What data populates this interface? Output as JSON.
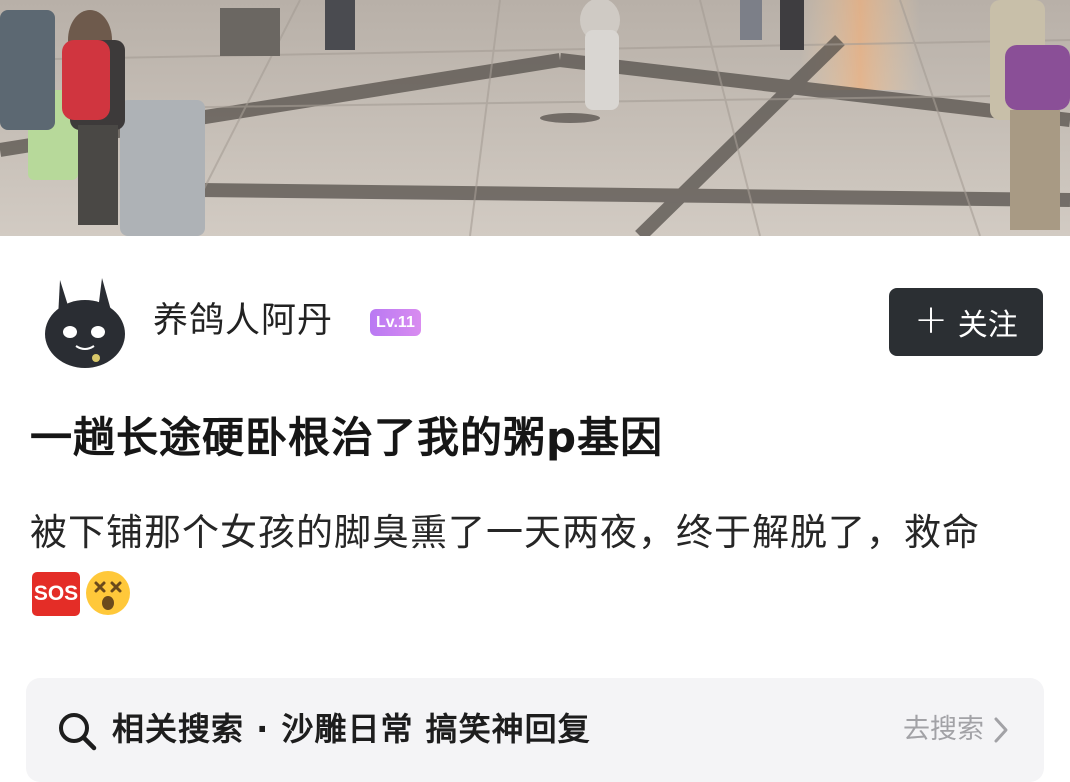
{
  "author": {
    "name": "养鸽人阿丹",
    "level": "Lv.11",
    "follow_label": "关注"
  },
  "post": {
    "title": "一趟长途硬卧根治了我的粥p基因",
    "body_text": "被下铺那个女孩的脚臭熏了一天两夜，终于解脱了，救命",
    "emoji_sos": "SOS"
  },
  "related_search": {
    "label": "相关搜索 · 沙雕日常 搞笑神回复",
    "action_label": "去搜索"
  },
  "icons": {
    "follow": "plus-icon",
    "search": "search-icon",
    "go": "chevron-right-icon",
    "emoji": "dizzy-face-emoji"
  },
  "colors": {
    "follow_button_bg": "#2b2f33",
    "level_badge": "#c47ff2",
    "sos_badge": "#e42d27",
    "search_bar_bg": "#f4f4f6"
  }
}
